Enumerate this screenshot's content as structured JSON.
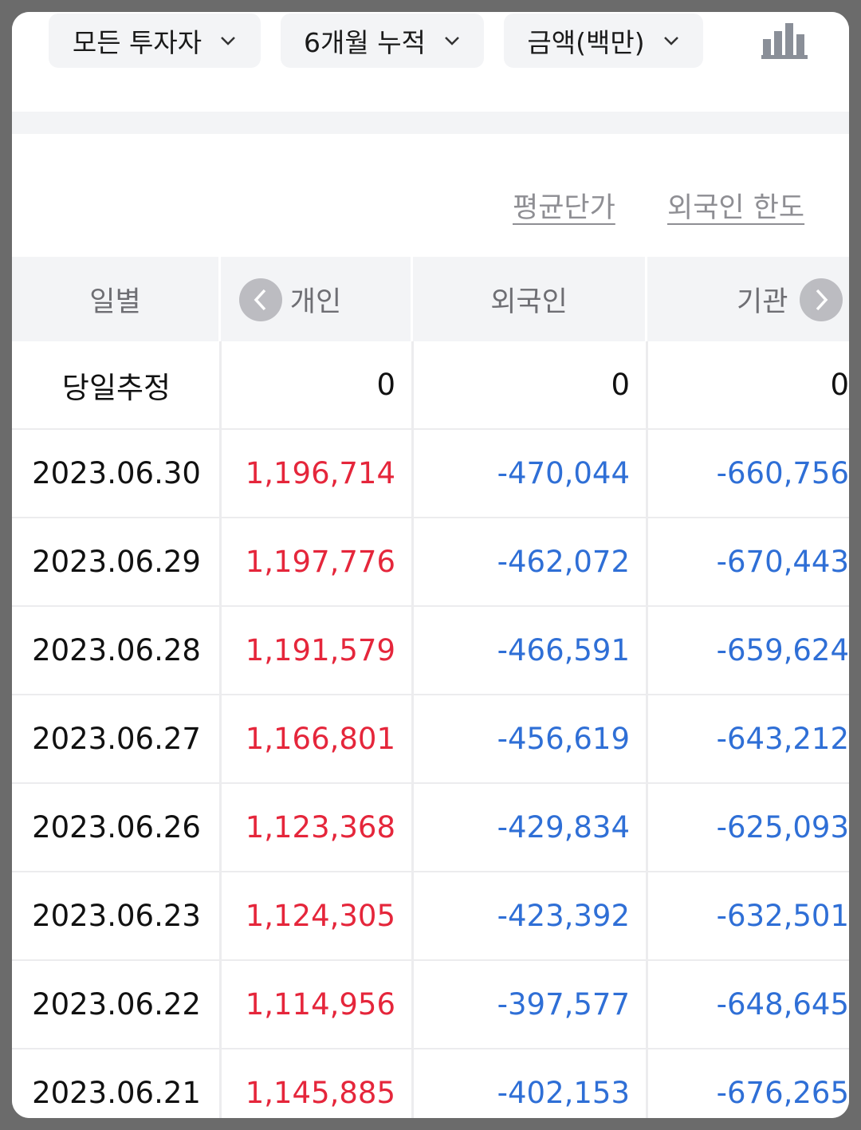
{
  "filters": {
    "investor": "모든 투자자",
    "period": "6개월 누적",
    "unit": "금액(백만)"
  },
  "icons": {
    "chart": "bar-chart-icon",
    "dropdown": "chevron-down-icon",
    "prev": "chevron-left-icon",
    "next": "chevron-right-icon"
  },
  "colors": {
    "positive": "#e5263b",
    "negative": "#2f6fd6",
    "header_bg": "#f3f4f6"
  },
  "links": {
    "avg_price": "평균단가",
    "foreign_limit": "외국인 한도"
  },
  "table": {
    "headers": [
      "일별",
      "개인",
      "외국인",
      "기관"
    ],
    "rows": [
      {
        "date": "당일추정",
        "individual": "0",
        "foreign": "0",
        "institution": "0"
      },
      {
        "date": "2023.06.30",
        "individual": "1,196,714",
        "foreign": "-470,044",
        "institution": "-660,756"
      },
      {
        "date": "2023.06.29",
        "individual": "1,197,776",
        "foreign": "-462,072",
        "institution": "-670,443"
      },
      {
        "date": "2023.06.28",
        "individual": "1,191,579",
        "foreign": "-466,591",
        "institution": "-659,624"
      },
      {
        "date": "2023.06.27",
        "individual": "1,166,801",
        "foreign": "-456,619",
        "institution": "-643,212"
      },
      {
        "date": "2023.06.26",
        "individual": "1,123,368",
        "foreign": "-429,834",
        "institution": "-625,093"
      },
      {
        "date": "2023.06.23",
        "individual": "1,124,305",
        "foreign": "-423,392",
        "institution": "-632,501"
      },
      {
        "date": "2023.06.22",
        "individual": "1,114,956",
        "foreign": "-397,577",
        "institution": "-648,645"
      },
      {
        "date": "2023.06.21",
        "individual": "1,145,885",
        "foreign": "-402,153",
        "institution": "-676,265"
      }
    ]
  }
}
